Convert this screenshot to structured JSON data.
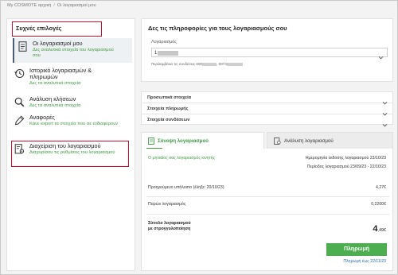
{
  "breadcrumb": {
    "home": "My COSMOTE αρχική",
    "current": "Οι λογαριασμοί μου"
  },
  "sidebar": {
    "title": "Συχνές επιλογές",
    "items": [
      {
        "title": "Οι λογαριασμοί μου",
        "subtitle": "Δες αναλυτικά στοιχεία του λογαριασμού σου",
        "icon": "document-icon"
      },
      {
        "title": "Ιστορικό λογαριασμών & πληρωμών",
        "subtitle": "Δες τα αναλυτικά στοιχεία",
        "icon": "history-icon"
      },
      {
        "title": "Ανάλυση κλήσεων",
        "subtitle": "Δες τα αναλυτικά στοιχεία",
        "icon": "search-icon"
      },
      {
        "title": "Αναφορές",
        "subtitle": "Κάνε export τα στοιχεία που σε ενδιαφέρουν",
        "icon": "pen-icon"
      },
      {
        "title": "Διαχείριση του λογαριασμού",
        "subtitle": "Διαχειρίσου τις ρυθμίσεις του λογαριασμού",
        "icon": "settings-document-icon"
      }
    ]
  },
  "main": {
    "title": "Δες τις πληροφορίες για τους λογαριασμούς σου",
    "account_label": "Λογαριασμός",
    "account_value": "1.",
    "account_note_prefix": "Περιλαμβάνει τις συνδέσεις 690",
    "account_note_mid": ", 6974"
  },
  "accordion": [
    {
      "label": "Προσωπικά στοιχεία"
    },
    {
      "label": "Στοιχεία πληρωμής"
    },
    {
      "label": "Στοιχεία συνδέσεων"
    }
  ],
  "tabs": {
    "summary": "Σύνοψη λογαριασμού",
    "analysis": "Ανάλυση λογαριασμού"
  },
  "summary": {
    "paid_note": "Ο μηνιαίος σας λογαριασμός κινητής",
    "issue_date_label": "Ημερομηνία έκδοσης λογαριασμού",
    "issue_date": "23/10/23",
    "period_label": "Περίοδος λογαριασμού",
    "period": "23/09/23 - 22/10/23",
    "previous_label": "Προηγούμενο υπόλοιπο (έληξε: 20/10/23)",
    "previous_value": "4,27€",
    "current_label": "Παρών λογαριασμός",
    "current_value": "0,2200€",
    "total_label_1": "Σύνολο λογαριασμού",
    "total_label_2": "με στρογγυλοποίηση",
    "total_big": "4",
    "total_small": ",49€",
    "pay_button": "Πληρωμή",
    "pay_until": "Πληρωμή έως 22/11/23"
  },
  "colors": {
    "accent_green": "#3f9a42",
    "button_green": "#4cae50",
    "highlight_red": "#c8102e"
  }
}
